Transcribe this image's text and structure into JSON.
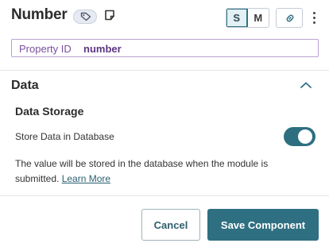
{
  "header": {
    "title": "Number",
    "tag_icon": "tag-icon",
    "note_icon": "note-icon",
    "size_options": [
      {
        "label": "S",
        "selected": true
      },
      {
        "label": "M",
        "selected": false
      }
    ],
    "link_icon": "link-icon",
    "menu_icon": "more-vertical-icon"
  },
  "property": {
    "label": "Property ID",
    "value": "number"
  },
  "data_section": {
    "title": "Data",
    "collapse_icon": "chevron-up-icon",
    "storage": {
      "title": "Data Storage",
      "toggle_label": "Store Data in Database",
      "toggle_on": true,
      "help_text": "The value will be stored in the database when the module is submitted.",
      "help_link": "Learn More"
    }
  },
  "footer": {
    "cancel_label": "Cancel",
    "save_label": "Save Component"
  },
  "colors": {
    "accent": "#2f6f82",
    "property_purple": "#5b3583",
    "divider": "#e2e5e9"
  }
}
